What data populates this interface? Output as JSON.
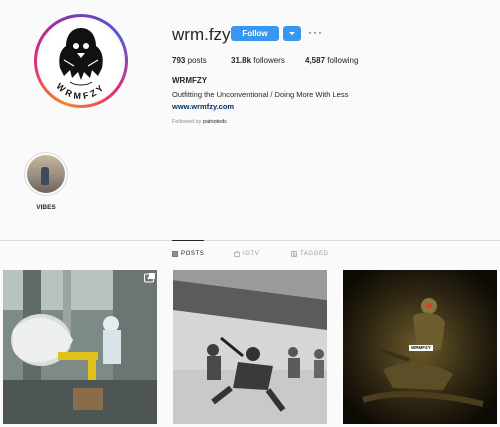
{
  "profile": {
    "username": "wrm.fzy",
    "follow_label": "Follow",
    "more_label": "···",
    "avatar_text": "WRMFZY",
    "posts_count": "793",
    "posts_label": "posts",
    "followers_count": "31.8k",
    "followers_label": "followers",
    "following_count": "4,587",
    "following_label": "following",
    "full_name": "WRMFZY",
    "bio": "Outfitting the Unconventional / Doing More With Less",
    "website": "www.wrmfzy.com",
    "followed_by_prefix": "Followed by",
    "followed_by_user": "patriotedc"
  },
  "highlights": [
    {
      "label": "VIBES"
    }
  ],
  "tabs": [
    {
      "label": "POSTS",
      "icon": "grid-icon",
      "active": true
    },
    {
      "label": "IGTV",
      "icon": "igtv-icon",
      "active": false
    },
    {
      "label": "TAGGED",
      "icon": "tagged-icon",
      "active": false
    }
  ],
  "posts": [
    {
      "description_icon": "video-icon",
      "badge": ""
    },
    {
      "badge": ""
    },
    {
      "badge": "WRMFZY"
    }
  ],
  "colors": {
    "accent": "#3897f0",
    "link": "#003569",
    "muted": "#8e8e8e",
    "border": "#dbdbdb"
  }
}
